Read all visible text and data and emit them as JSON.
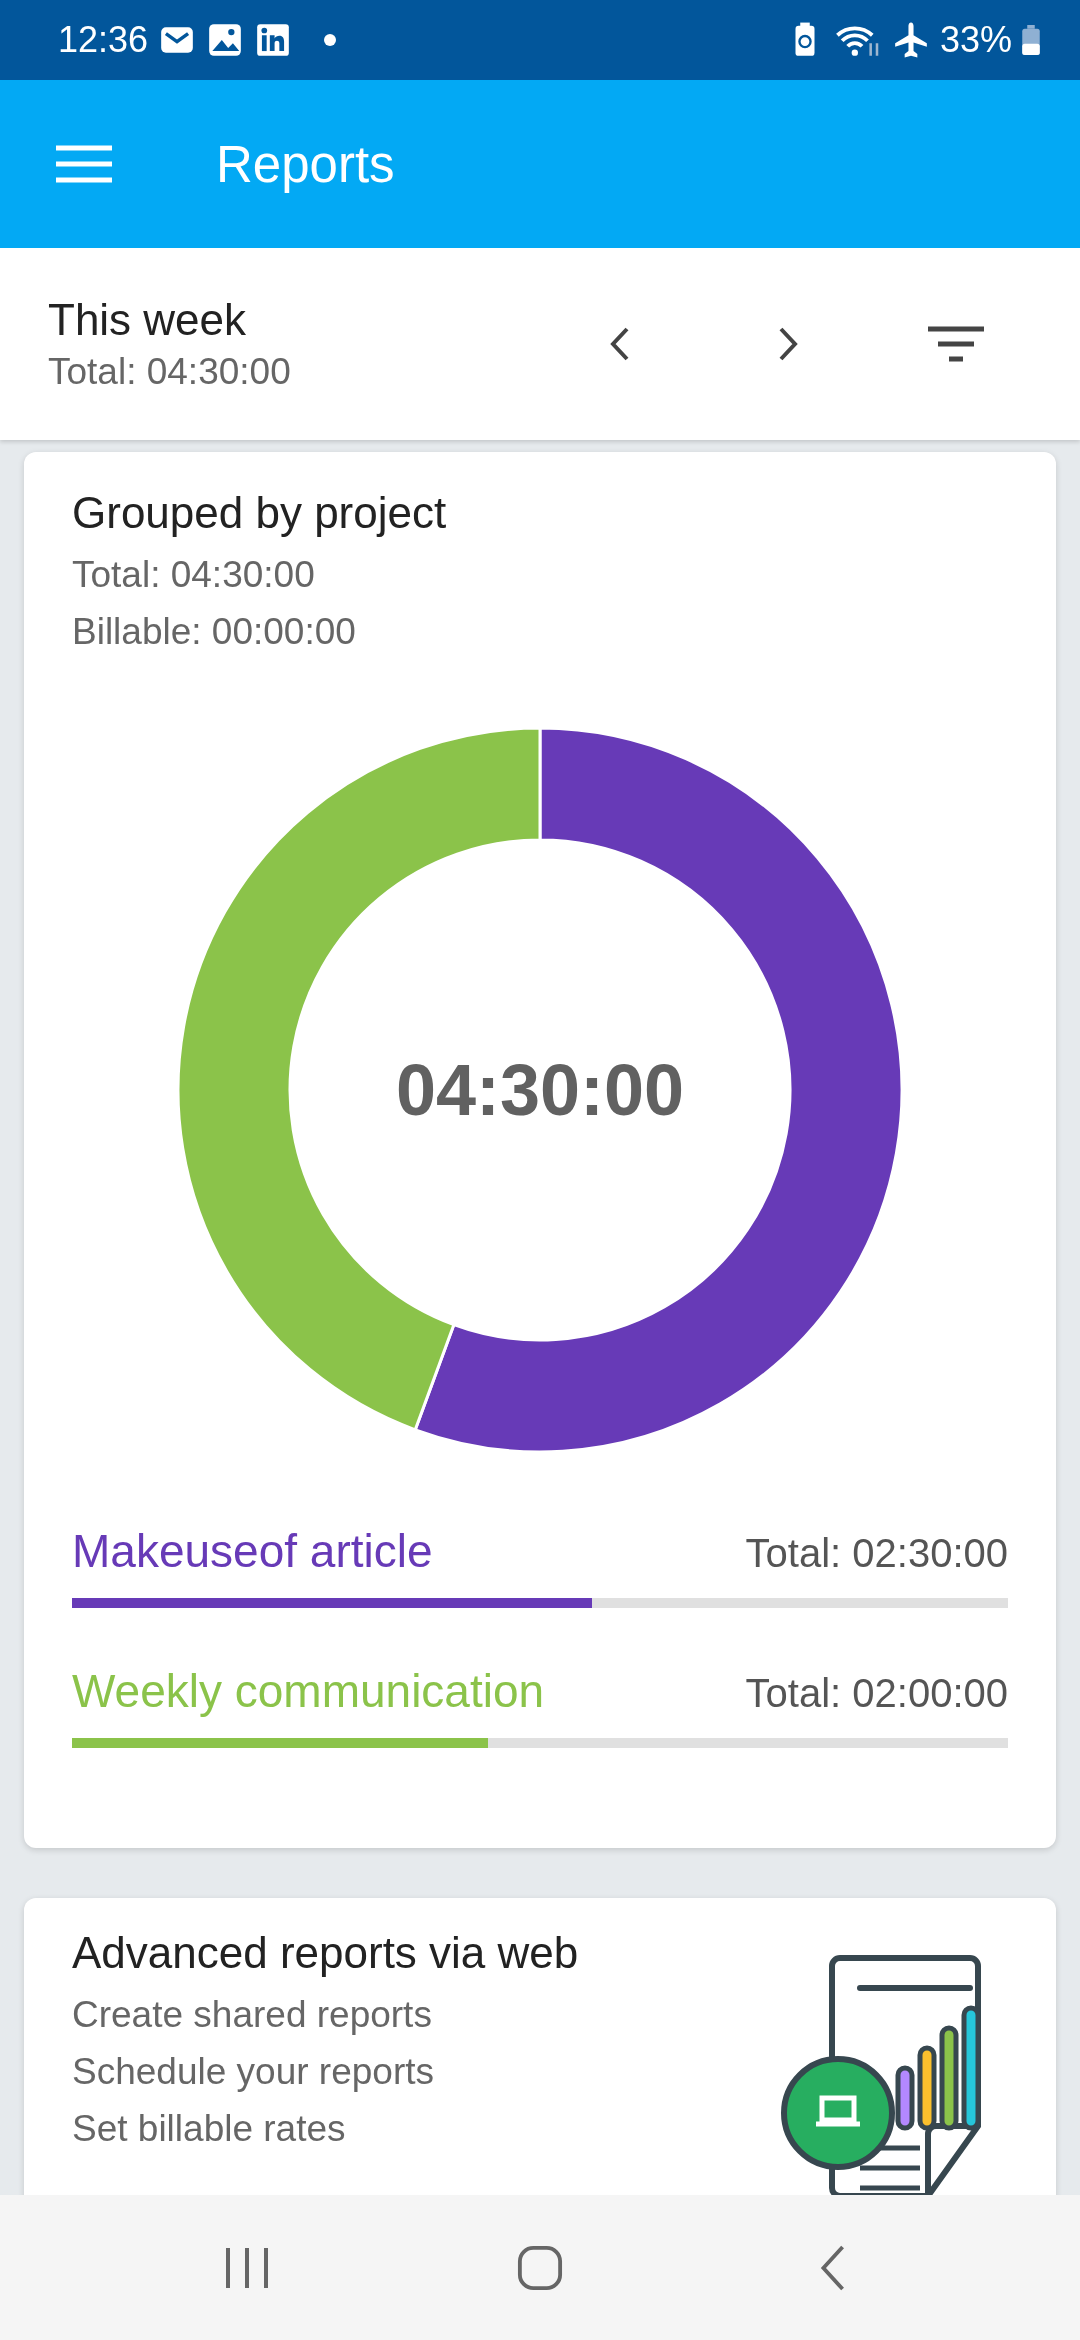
{
  "status_bar": {
    "time": "12:36",
    "battery": "33%"
  },
  "app_bar": {
    "title": "Reports"
  },
  "period": {
    "title": "This week",
    "total": "Total: 04:30:00"
  },
  "project_card": {
    "title": "Grouped by project",
    "total": "Total: 04:30:00",
    "billable": "Billable: 00:00:00",
    "center_label": "04:30:00",
    "chart_data": {
      "type": "donut",
      "categories": [
        "Makeuseof article",
        "Weekly communication"
      ],
      "values": [
        55.6,
        44.4
      ]
    },
    "projects": [
      {
        "total": "Total: 02:30:00",
        "level": 0.556,
        "color": "#673ab7"
      },
      {
        "total": "Total: 02:00:00",
        "level": 0.444,
        "color": "#8bc34a"
      }
    ]
  },
  "web_card": {
    "title": "Advanced reports via web",
    "lines": [
      "Create shared reports",
      "Schedule your reports",
      "Set billable rates"
    ]
  }
}
